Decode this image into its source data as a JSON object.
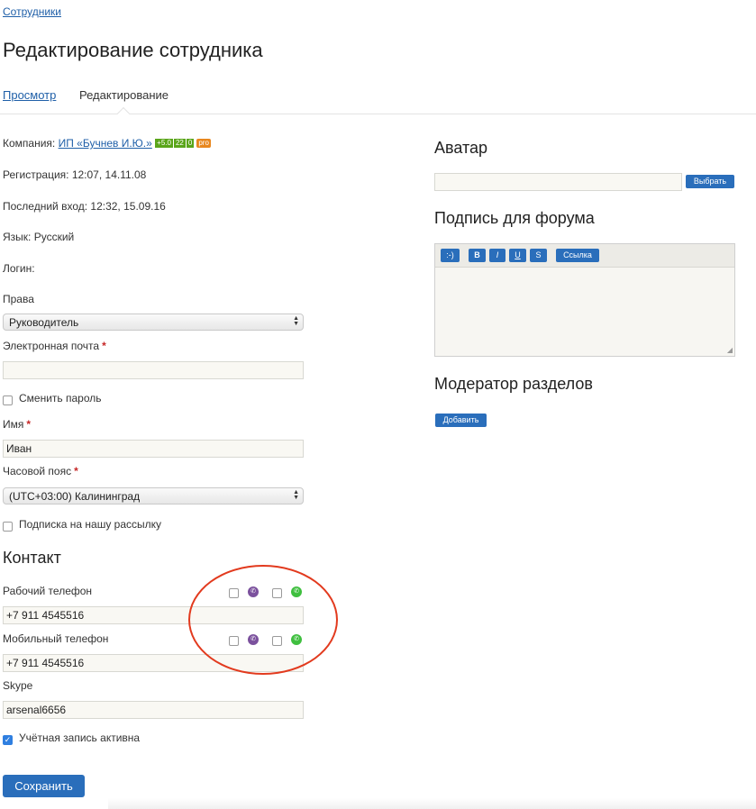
{
  "breadcrumb": "Сотрудники",
  "page_title": "Редактирование сотрудника",
  "tabs": {
    "view": "Просмотр",
    "edit": "Редактирование"
  },
  "info": {
    "company_label": "Компания:",
    "company_name": "ИП «Бучнев И.Ю.»",
    "badges": [
      "+5.0",
      "22",
      "0",
      "pro"
    ],
    "registration": "Регистрация: 12:07, 14.11.08",
    "last_login": "Последний вход: 12:32, 15.09.16",
    "language": "Язык: Русский",
    "login": "Логин:"
  },
  "form": {
    "rights_label": "Права",
    "rights_value": "Руководитель",
    "email_label": "Электронная почта",
    "email_value": "",
    "change_password": "Сменить пароль",
    "name_label": "Имя",
    "name_value": "Иван",
    "timezone_label": "Часовой пояс",
    "timezone_value": "(UTC+03:00) Калининград",
    "newsletter": "Подписка на нашу рассылку",
    "required_mark": "*"
  },
  "contact": {
    "heading": "Контакт",
    "work_phone_label": "Рабочий телефон",
    "work_phone_value": "+7 911 4545516",
    "mobile_phone_label": "Мобильный телефон",
    "mobile_phone_value": "+7 911 4545516",
    "skype_label": "Skype",
    "skype_value": "arsenal6656",
    "account_active": "Учётная запись активна"
  },
  "save_button": "Сохранить",
  "right": {
    "avatar_heading": "Аватар",
    "choose_button": "Выбрать",
    "signature_heading": "Подпись для форума",
    "toolbar": {
      "smiley": ":-)",
      "bold": "B",
      "italic": "I",
      "underline": "U",
      "strike": "S",
      "link": "Ссылка"
    },
    "moderator_heading": "Модератор разделов",
    "add_button": "Добавить"
  },
  "icons": {
    "viber": "viber-icon",
    "whatsapp": "whatsapp-icon"
  },
  "colors": {
    "accent": "#2a6ebb",
    "annotation_circle": "#e23a1e",
    "required": "#c62828"
  }
}
